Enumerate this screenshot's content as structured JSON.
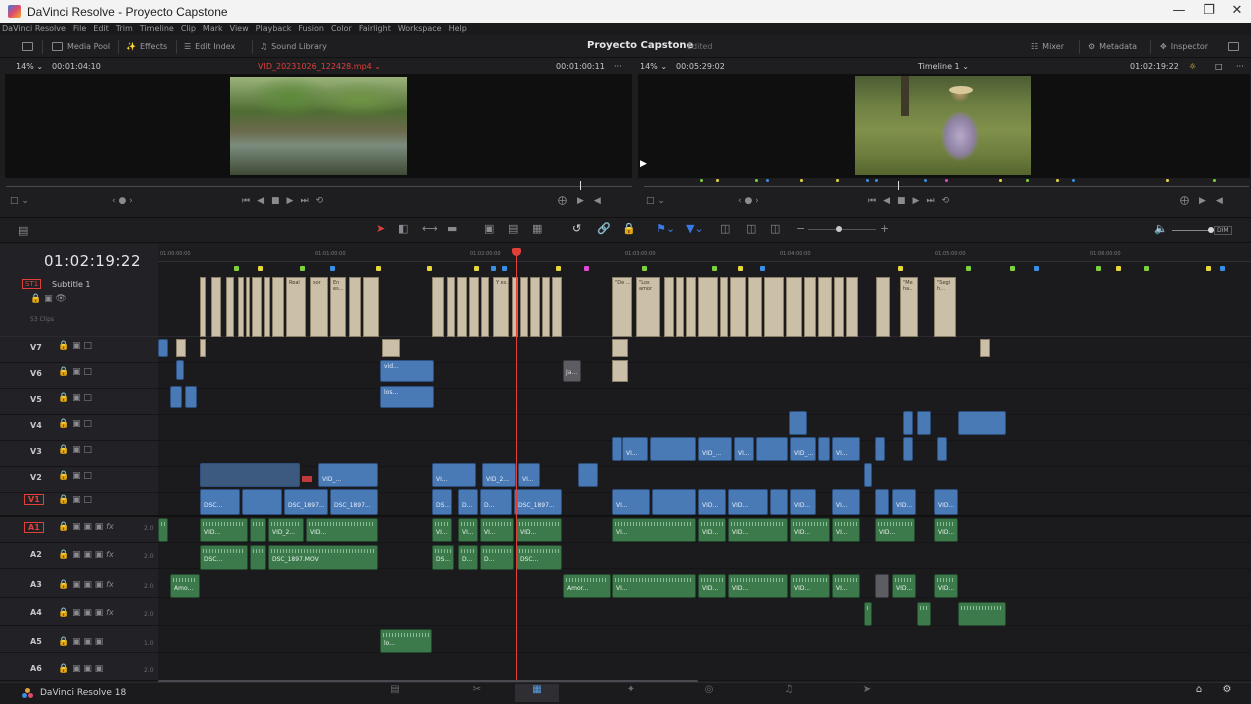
{
  "window": {
    "title": "DaVinci Resolve - Proyecto Capstone"
  },
  "menu": [
    "DaVinci Resolve",
    "File",
    "Edit",
    "Trim",
    "Timeline",
    "Clip",
    "Mark",
    "View",
    "Playback",
    "Fusion",
    "Color",
    "Fairlight",
    "Workspace",
    "Help"
  ],
  "toolbar": {
    "media_pool": "Media Pool",
    "effects": "Effects",
    "edit_index": "Edit Index",
    "sound_library": "Sound Library",
    "project": "Proyecto Capstone",
    "status": "Edited",
    "mixer": "Mixer",
    "metadata": "Metadata",
    "inspector": "Inspector"
  },
  "source_viewer": {
    "zoom": "14%",
    "timecode": "00:01:04:10",
    "clip_name": "VID_20231026_122428.mp4",
    "duration": "00:01:00:11"
  },
  "timeline_viewer": {
    "zoom": "14%",
    "timecode": "00:05:29:02",
    "name": "Timeline 1",
    "current": "01:02:19:22"
  },
  "timeline": {
    "timecode": "01:02:19:22",
    "ruler": [
      "01:00:00:00",
      "01:01:00:00",
      "01:02:00:00",
      "01:03:00:00",
      "01:04:00:00",
      "01:05:00:00",
      "01:06:00:00"
    ],
    "subtitle": {
      "tag": "ST1",
      "name": "Subtitle 1",
      "count": "53 Clips"
    },
    "video_tracks": [
      "V7",
      "V6",
      "V5",
      "V4",
      "V3",
      "V2",
      "V1"
    ],
    "audio_tracks": [
      "A1",
      "A2",
      "A3",
      "A4",
      "A5",
      "A6"
    ],
    "audio_levels": [
      "2.0",
      "2.0",
      "2.0",
      "2.0",
      "1.0",
      "2.0"
    ]
  },
  "clips": {
    "sub_real": "Real",
    "sub_sor": "sor",
    "sub_en": "En es...",
    "sub_y": "Y es.",
    "sub_de": "\"De ...",
    "sub_los": "\"Los amor",
    "sub_me": "\"Me ha..",
    "sub_segi": "\"Segi h...",
    "v6a": "vid...",
    "v6b": "Ja...",
    "v5a": "los...",
    "v3a": "VI...",
    "v3b": "VID_...",
    "v3c": "VI...",
    "v3d": "VID_...",
    "v3e": "VI...",
    "v2a": "VID_...",
    "v2b": "VI...",
    "v2c": "VID_2...",
    "v2d": "VI...",
    "v1a": "DSC...",
    "v1b": "DSC_1897...",
    "v1c": "DSC_1897...",
    "v1d": "DS...",
    "v1e": "D...",
    "v1f": "D...",
    "v1g": "DSC_1897...",
    "v1h": "VI...",
    "v1i": "VID...",
    "v1j": "VID...",
    "v1k": "VID...",
    "v1l": "VI...",
    "v1m": "VID...",
    "v1n": "VID...",
    "a1a": "VID...",
    "a1b": "VID_2...",
    "a1c": "VID...",
    "a1d": "VI...",
    "a1e": "VI...",
    "a1f": "VI...",
    "a1g": "VID...",
    "a1h": "VI...",
    "a1i": "VID...",
    "a1j": "VID...",
    "a1k": "VID...",
    "a1l": "VI...",
    "a1m": "VID...",
    "a1n": "VID...",
    "a2a": "DSC...",
    "a2b": "DSC_1897.MOV",
    "a2c": "DS...",
    "a2d": "D...",
    "a2e": "D...",
    "a2f": "DSC...",
    "a3a": "Amo...",
    "a3b": "Amor...",
    "a3c": "VI...",
    "a3d": "VID...",
    "a3e": "VID...",
    "a3f": "VID...",
    "a3g": "VI...",
    "a3h": "VID...",
    "a3i": "VID...",
    "a5a": "lo..."
  },
  "bottom": {
    "app": "DaVinci Resolve 18"
  },
  "colors": {
    "accent_red": "#e0403a",
    "video_clip": "#4a7ab6",
    "audio_clip": "#3d7a4b",
    "subtitle_clip": "#cbbfa8"
  }
}
